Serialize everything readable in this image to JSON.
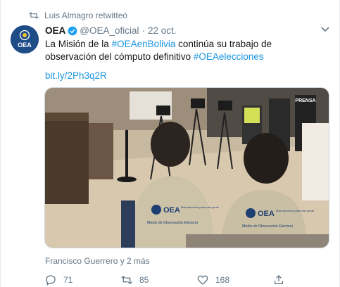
{
  "retweet": {
    "text": "Luis Almagro retwitteó",
    "icon": "retweet-icon"
  },
  "tweet": {
    "avatar_text": "OEA",
    "author_name": "OEA",
    "handle": "@OEA_oficial",
    "separator": "·",
    "date": "22 oct.",
    "text_part1": "La Misión de la ",
    "hashtag1": "#OEAenBolivia",
    "text_part2": " continúa su trabajo de observación del cómputo definitivo ",
    "hashtag2": "#OEAelecciones",
    "link": "bit.ly/2Ph3q2R",
    "photo": {
      "vest_brand": "OEA",
      "vest_tagline": "Más derechos para más gente",
      "vest_mission": "Misión de Observación Electoral",
      "press_vest": "PRENSA"
    },
    "tagged": "Francisco Guerrero y 2 más"
  },
  "actions": {
    "reply_count": "71",
    "retweet_count": "85",
    "like_count": "168"
  },
  "colors": {
    "link_blue": "#1b95e0",
    "secondary_text": "#657786",
    "avatar_bg": "#1e4c87"
  }
}
